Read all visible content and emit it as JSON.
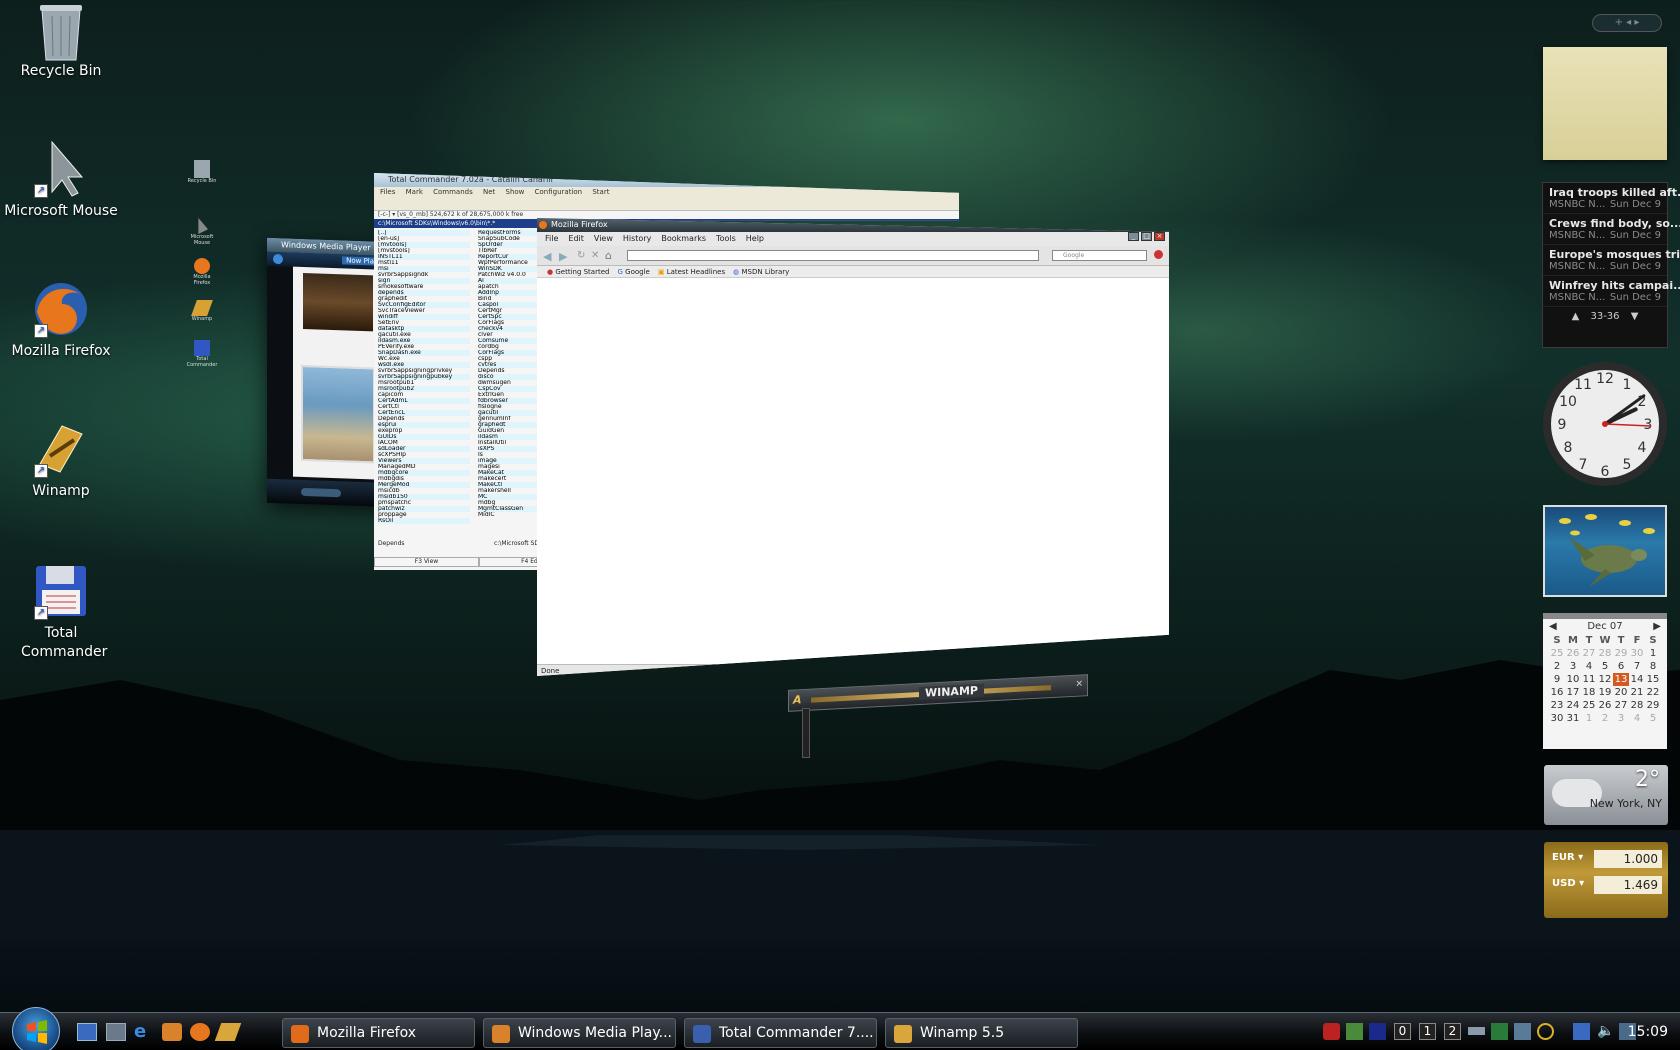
{
  "desktop": {
    "icons": [
      {
        "label": "Recycle Bin"
      },
      {
        "label": "Microsoft Mouse"
      },
      {
        "label": "Mozilla Firefox"
      },
      {
        "label": "Winamp"
      },
      {
        "label": "Total Commander"
      }
    ],
    "mini_icons": [
      "Recycle Bin",
      "Microsoft Mouse",
      "Mozilla Firefox",
      "Winamp",
      "Total Commander"
    ]
  },
  "windows": {
    "total_commander": {
      "title": "Total Commander 7.02a - Catalin Canarili",
      "menu": [
        "Files",
        "Mark",
        "Commands",
        "Net",
        "Show",
        "Configuration",
        "Start"
      ],
      "status_line": "[-c-] ▾  [vs_0_mb]  524,672 k of 28,675,000 k free",
      "path": "c:\\Microsoft SDKs\\Windows\\v6.0\\bin\\*.*",
      "files_left": [
        "[..]",
        "[en-us]",
        "[mvtools]",
        "[mvstools]",
        "INSTL11",
        "mstl11",
        "msi",
        "svrbrSappsigndk",
        "sign",
        "smokesoftware",
        "depends",
        "graphedit",
        "SvcConfigEditor",
        "SvcTraceViewer",
        "windiff",
        "SetEnv",
        "datasktp",
        "gacutil.exe",
        "ildasm.exe",
        "PEVerify.exe",
        "SnapDash.exe",
        "Wc.exe",
        "wsdl.exe",
        "svrbrSappsigningprivkey",
        "svrbrSappsigningpubkey",
        "msrootpub1",
        "msrootpub2",
        "capicom",
        "CertAdmL",
        "CertCtl",
        "CertEncL",
        "Depends",
        "esprui",
        "exeprop",
        "GUIDs",
        "IACOM",
        "sdLoader",
        "scXPSHlp",
        "Viewers",
        "ManagedMD",
        "mdbgcore",
        "mdbgdis",
        "MergeMod",
        "msicdb",
        "msidb150",
        "pmspatchc",
        "patchwiz",
        "proppage",
        "RsOil"
      ],
      "files_right": [
        "RequestForms",
        "SnapSubCode",
        "SpOrder",
        "TlbRef",
        "ReportCur",
        "WpfPerformance",
        "WinSDK",
        "PatchWiz v4.0.0",
        "Al",
        "apatch",
        "Addlnp",
        "Bind",
        "Caspol",
        "CertMgr",
        "CertSpc",
        "CorFlags",
        "checkv4",
        "clver",
        "Comsume",
        "cordbg",
        "CorFlags",
        "cspp",
        "cvtres",
        "Depends",
        "disco",
        "dwmsugen",
        "CspCov",
        "ExtrlGen",
        "fdbrowser",
        "fislogne",
        "gacutil",
        "gennumInf",
        "graphedt",
        "GuidGen",
        "ildasm",
        "InstallUtil",
        "isXPS",
        "Is",
        "image",
        "magesi",
        "MakeCat",
        "makecert",
        "MakeCtl",
        "makershell",
        "MC",
        "mdbg",
        "MgmtClassGen",
        "MidlC"
      ],
      "bottom_label": "Depends",
      "bottom_path": "c:\\Microsoft SD",
      "fkeys": [
        "F3 View",
        "F4 Edit"
      ]
    },
    "wmp": {
      "title": "Windows Media Player",
      "tab": "Now Playing"
    },
    "firefox": {
      "title": "Mozilla Firefox",
      "menu": [
        "File",
        "Edit",
        "View",
        "History",
        "Bookmarks",
        "Tools",
        "Help"
      ],
      "bookmarks": [
        "Getting Started",
        "Google",
        "Latest Headlines",
        "MSDN Library"
      ],
      "search_placeholder": "Google",
      "status": "Done"
    },
    "winamp": {
      "title": "WINAMP",
      "logo": "A"
    }
  },
  "sidebar": {
    "news": [
      {
        "headline": "Iraq troops killed aft...",
        "source": "MSNBC N...",
        "date": "Sun Dec 9"
      },
      {
        "headline": "Crews find body, so...",
        "source": "MSNBC N...",
        "date": "Sun Dec 9"
      },
      {
        "headline": "Europe's mosques tri...",
        "source": "MSNBC N...",
        "date": "Sun Dec 9"
      },
      {
        "headline": "Winfrey hits campai...",
        "source": "MSNBC N...",
        "date": "Sun Dec 9"
      }
    ],
    "news_pager": "33-36",
    "clock": {
      "hour": 2,
      "minute": 9
    },
    "calendar": {
      "month": "Dec 07",
      "weekdays": [
        "S",
        "M",
        "T",
        "W",
        "T",
        "F",
        "S"
      ],
      "weeks": [
        [
          [
            "25",
            "dim"
          ],
          [
            "26",
            "dim"
          ],
          [
            "27",
            "dim"
          ],
          [
            "28",
            "dim"
          ],
          [
            "29",
            "dim"
          ],
          [
            "30",
            "dim"
          ],
          [
            "1",
            ""
          ]
        ],
        [
          [
            "2",
            ""
          ],
          [
            "3",
            ""
          ],
          [
            "4",
            ""
          ],
          [
            "5",
            ""
          ],
          [
            "6",
            ""
          ],
          [
            "7",
            ""
          ],
          [
            "8",
            ""
          ]
        ],
        [
          [
            "9",
            ""
          ],
          [
            "10",
            ""
          ],
          [
            "11",
            ""
          ],
          [
            "12",
            ""
          ],
          [
            "13",
            "today"
          ],
          [
            "14",
            ""
          ],
          [
            "15",
            ""
          ]
        ],
        [
          [
            "16",
            ""
          ],
          [
            "17",
            ""
          ],
          [
            "18",
            ""
          ],
          [
            "19",
            ""
          ],
          [
            "20",
            ""
          ],
          [
            "21",
            ""
          ],
          [
            "22",
            ""
          ]
        ],
        [
          [
            "23",
            ""
          ],
          [
            "24",
            ""
          ],
          [
            "25",
            ""
          ],
          [
            "26",
            ""
          ],
          [
            "27",
            ""
          ],
          [
            "28",
            ""
          ],
          [
            "29",
            ""
          ]
        ],
        [
          [
            "30",
            ""
          ],
          [
            "31",
            ""
          ],
          [
            "1",
            "dim"
          ],
          [
            "2",
            "dim"
          ],
          [
            "3",
            "dim"
          ],
          [
            "4",
            "dim"
          ],
          [
            "5",
            "dim"
          ]
        ]
      ]
    },
    "weather": {
      "temp": "2°",
      "city": "New York, NY"
    },
    "currency": [
      {
        "code": "EUR",
        "value": "1.000"
      },
      {
        "code": "USD",
        "value": "1.469"
      }
    ]
  },
  "taskbar": {
    "buttons": [
      {
        "label": "Mozilla Firefox",
        "color": "#e06b1a"
      },
      {
        "label": "Windows Media Play...",
        "color": "#d9822b"
      },
      {
        "label": "Total Commander 7....",
        "color": "#3a5fae"
      },
      {
        "label": "Winamp 5.5",
        "color": "#d8a63a"
      }
    ],
    "tray_numbers": [
      "0",
      "1",
      "2"
    ],
    "clock": "15:09"
  }
}
